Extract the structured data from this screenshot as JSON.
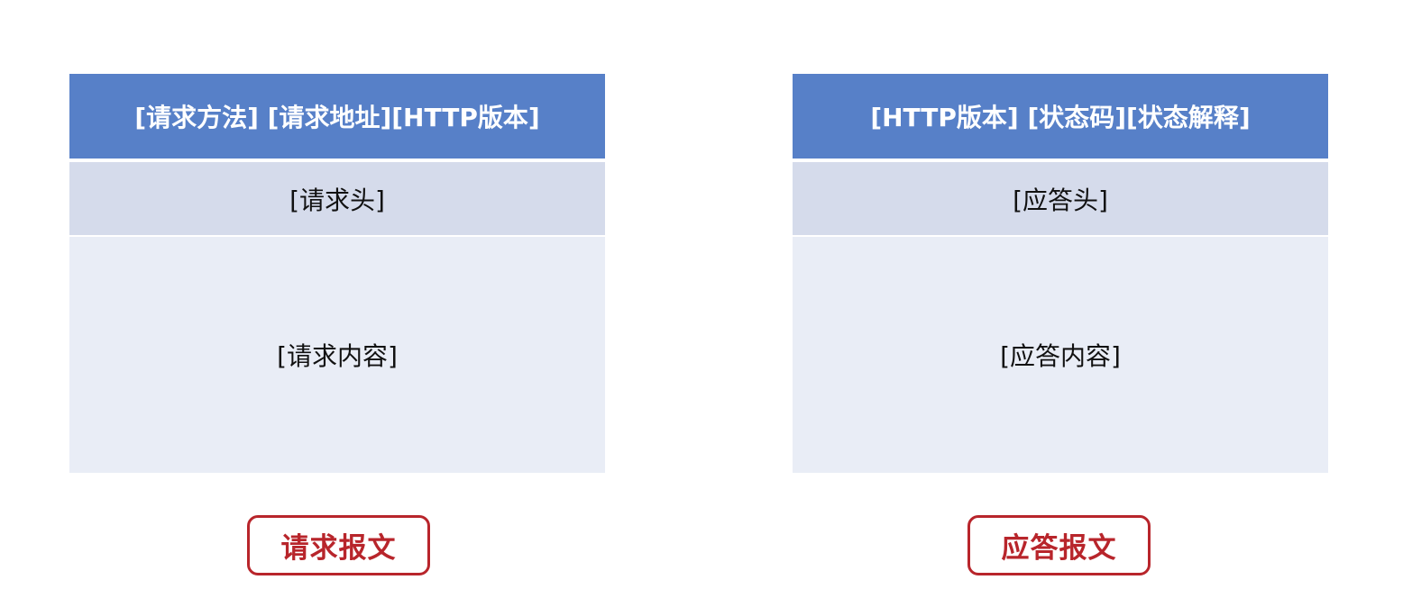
{
  "request": {
    "start_line": "[请求方法] [请求地址][HTTP版本]",
    "headers": "[请求头]",
    "body": "[请求内容]",
    "caption": "请求报文"
  },
  "response": {
    "start_line": "[HTTP版本] [状态码][状态解释]",
    "headers": "[应答头]",
    "body": "[应答内容]",
    "caption": "应答报文"
  },
  "colors": {
    "header_bg": "#5780c8",
    "headers_bg": "#d5dbeb",
    "body_bg": "#e9edf6",
    "caption_accent": "#b8252b"
  }
}
